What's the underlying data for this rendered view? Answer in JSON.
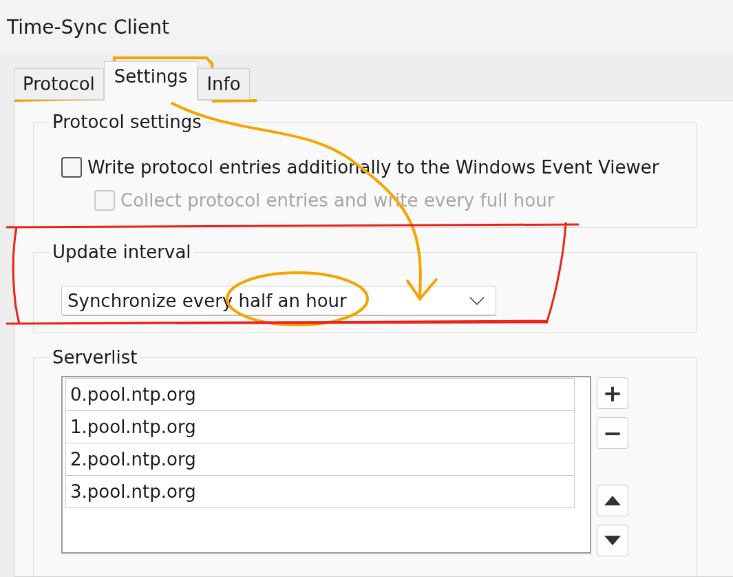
{
  "window": {
    "title": "Time-Sync Client"
  },
  "tabs": [
    {
      "label": "Protocol",
      "selected": false
    },
    {
      "label": "Settings",
      "selected": true
    },
    {
      "label": "Info",
      "selected": false
    }
  ],
  "protocol_settings": {
    "title": "Protocol settings",
    "options": [
      {
        "label": "Write protocol entries additionally to the Windows Event Viewer",
        "checked": false,
        "disabled": false
      },
      {
        "label": "Collect protocol entries and write every full hour",
        "checked": false,
        "disabled": true
      }
    ]
  },
  "update_interval": {
    "title": "Update interval",
    "value": "Synchronize every half an hour"
  },
  "serverlist": {
    "title": "Serverlist",
    "rows": [
      "0.pool.ntp.org",
      "1.pool.ntp.org",
      "2.pool.ntp.org",
      "3.pool.ntp.org"
    ],
    "add_button": "+",
    "remove_button": "−"
  }
}
